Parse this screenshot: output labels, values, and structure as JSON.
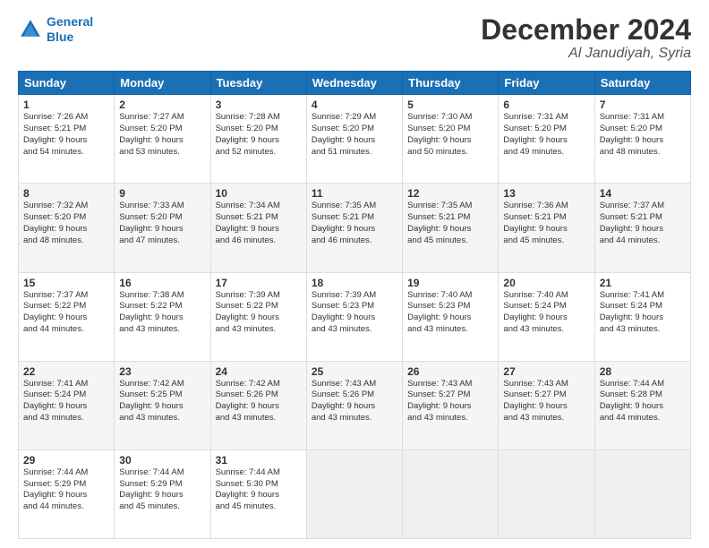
{
  "header": {
    "logo_line1": "General",
    "logo_line2": "Blue",
    "month": "December 2024",
    "location": "Al Janudiyah, Syria"
  },
  "days_of_week": [
    "Sunday",
    "Monday",
    "Tuesday",
    "Wednesday",
    "Thursday",
    "Friday",
    "Saturday"
  ],
  "weeks": [
    [
      {
        "day": "1",
        "lines": [
          "Sunrise: 7:26 AM",
          "Sunset: 5:21 PM",
          "Daylight: 9 hours",
          "and 54 minutes."
        ]
      },
      {
        "day": "2",
        "lines": [
          "Sunrise: 7:27 AM",
          "Sunset: 5:20 PM",
          "Daylight: 9 hours",
          "and 53 minutes."
        ]
      },
      {
        "day": "3",
        "lines": [
          "Sunrise: 7:28 AM",
          "Sunset: 5:20 PM",
          "Daylight: 9 hours",
          "and 52 minutes."
        ]
      },
      {
        "day": "4",
        "lines": [
          "Sunrise: 7:29 AM",
          "Sunset: 5:20 PM",
          "Daylight: 9 hours",
          "and 51 minutes."
        ]
      },
      {
        "day": "5",
        "lines": [
          "Sunrise: 7:30 AM",
          "Sunset: 5:20 PM",
          "Daylight: 9 hours",
          "and 50 minutes."
        ]
      },
      {
        "day": "6",
        "lines": [
          "Sunrise: 7:31 AM",
          "Sunset: 5:20 PM",
          "Daylight: 9 hours",
          "and 49 minutes."
        ]
      },
      {
        "day": "7",
        "lines": [
          "Sunrise: 7:31 AM",
          "Sunset: 5:20 PM",
          "Daylight: 9 hours",
          "and 48 minutes."
        ]
      }
    ],
    [
      {
        "day": "8",
        "lines": [
          "Sunrise: 7:32 AM",
          "Sunset: 5:20 PM",
          "Daylight: 9 hours",
          "and 48 minutes."
        ]
      },
      {
        "day": "9",
        "lines": [
          "Sunrise: 7:33 AM",
          "Sunset: 5:20 PM",
          "Daylight: 9 hours",
          "and 47 minutes."
        ]
      },
      {
        "day": "10",
        "lines": [
          "Sunrise: 7:34 AM",
          "Sunset: 5:21 PM",
          "Daylight: 9 hours",
          "and 46 minutes."
        ]
      },
      {
        "day": "11",
        "lines": [
          "Sunrise: 7:35 AM",
          "Sunset: 5:21 PM",
          "Daylight: 9 hours",
          "and 46 minutes."
        ]
      },
      {
        "day": "12",
        "lines": [
          "Sunrise: 7:35 AM",
          "Sunset: 5:21 PM",
          "Daylight: 9 hours",
          "and 45 minutes."
        ]
      },
      {
        "day": "13",
        "lines": [
          "Sunrise: 7:36 AM",
          "Sunset: 5:21 PM",
          "Daylight: 9 hours",
          "and 45 minutes."
        ]
      },
      {
        "day": "14",
        "lines": [
          "Sunrise: 7:37 AM",
          "Sunset: 5:21 PM",
          "Daylight: 9 hours",
          "and 44 minutes."
        ]
      }
    ],
    [
      {
        "day": "15",
        "lines": [
          "Sunrise: 7:37 AM",
          "Sunset: 5:22 PM",
          "Daylight: 9 hours",
          "and 44 minutes."
        ]
      },
      {
        "day": "16",
        "lines": [
          "Sunrise: 7:38 AM",
          "Sunset: 5:22 PM",
          "Daylight: 9 hours",
          "and 43 minutes."
        ]
      },
      {
        "day": "17",
        "lines": [
          "Sunrise: 7:39 AM",
          "Sunset: 5:22 PM",
          "Daylight: 9 hours",
          "and 43 minutes."
        ]
      },
      {
        "day": "18",
        "lines": [
          "Sunrise: 7:39 AM",
          "Sunset: 5:23 PM",
          "Daylight: 9 hours",
          "and 43 minutes."
        ]
      },
      {
        "day": "19",
        "lines": [
          "Sunrise: 7:40 AM",
          "Sunset: 5:23 PM",
          "Daylight: 9 hours",
          "and 43 minutes."
        ]
      },
      {
        "day": "20",
        "lines": [
          "Sunrise: 7:40 AM",
          "Sunset: 5:24 PM",
          "Daylight: 9 hours",
          "and 43 minutes."
        ]
      },
      {
        "day": "21",
        "lines": [
          "Sunrise: 7:41 AM",
          "Sunset: 5:24 PM",
          "Daylight: 9 hours",
          "and 43 minutes."
        ]
      }
    ],
    [
      {
        "day": "22",
        "lines": [
          "Sunrise: 7:41 AM",
          "Sunset: 5:24 PM",
          "Daylight: 9 hours",
          "and 43 minutes."
        ]
      },
      {
        "day": "23",
        "lines": [
          "Sunrise: 7:42 AM",
          "Sunset: 5:25 PM",
          "Daylight: 9 hours",
          "and 43 minutes."
        ]
      },
      {
        "day": "24",
        "lines": [
          "Sunrise: 7:42 AM",
          "Sunset: 5:26 PM",
          "Daylight: 9 hours",
          "and 43 minutes."
        ]
      },
      {
        "day": "25",
        "lines": [
          "Sunrise: 7:43 AM",
          "Sunset: 5:26 PM",
          "Daylight: 9 hours",
          "and 43 minutes."
        ]
      },
      {
        "day": "26",
        "lines": [
          "Sunrise: 7:43 AM",
          "Sunset: 5:27 PM",
          "Daylight: 9 hours",
          "and 43 minutes."
        ]
      },
      {
        "day": "27",
        "lines": [
          "Sunrise: 7:43 AM",
          "Sunset: 5:27 PM",
          "Daylight: 9 hours",
          "and 43 minutes."
        ]
      },
      {
        "day": "28",
        "lines": [
          "Sunrise: 7:44 AM",
          "Sunset: 5:28 PM",
          "Daylight: 9 hours",
          "and 44 minutes."
        ]
      }
    ],
    [
      {
        "day": "29",
        "lines": [
          "Sunrise: 7:44 AM",
          "Sunset: 5:29 PM",
          "Daylight: 9 hours",
          "and 44 minutes."
        ]
      },
      {
        "day": "30",
        "lines": [
          "Sunrise: 7:44 AM",
          "Sunset: 5:29 PM",
          "Daylight: 9 hours",
          "and 45 minutes."
        ]
      },
      {
        "day": "31",
        "lines": [
          "Sunrise: 7:44 AM",
          "Sunset: 5:30 PM",
          "Daylight: 9 hours",
          "and 45 minutes."
        ]
      },
      null,
      null,
      null,
      null
    ]
  ]
}
